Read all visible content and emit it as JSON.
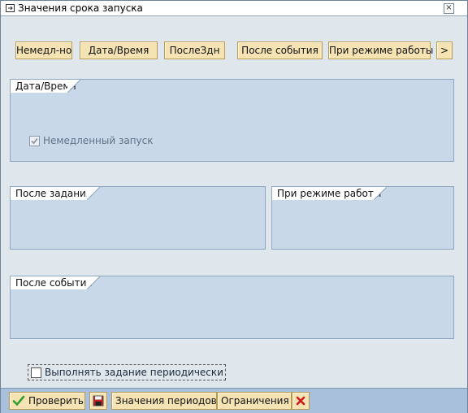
{
  "window": {
    "title": "Значения срока запуска",
    "close_glyph": "×"
  },
  "tabs": [
    {
      "label": "Немедл-но"
    },
    {
      "label": "Дата/Время"
    },
    {
      "label": "ПослеЗдн"
    },
    {
      "label": "После события"
    },
    {
      "label": "При режиме работы"
    },
    {
      "label": ">"
    }
  ],
  "groups": {
    "datetime": {
      "title": "Дата/Время",
      "immediate_label": "Немедленный запуск",
      "immediate_checked": true,
      "immediate_enabled": false
    },
    "after_job": {
      "title": "После задания"
    },
    "operation_mode": {
      "title": "При режиме работы"
    },
    "after_event": {
      "title": "После события"
    }
  },
  "periodic": {
    "label": "Выполнять задание периодически",
    "checked": false
  },
  "footer": {
    "check_label": "Проверить",
    "save_icon": "save-icon",
    "period_values_label": "Значения периодов",
    "restrictions_label": "Ограничения",
    "cancel_icon": "cancel-icon"
  },
  "colors": {
    "button_bg": "#f6e3b4",
    "group_bg": "#c8d8e8",
    "footer_bg": "#a8c0dc",
    "check_green": "#2e9e2e",
    "cancel_red": "#d01a1a"
  }
}
